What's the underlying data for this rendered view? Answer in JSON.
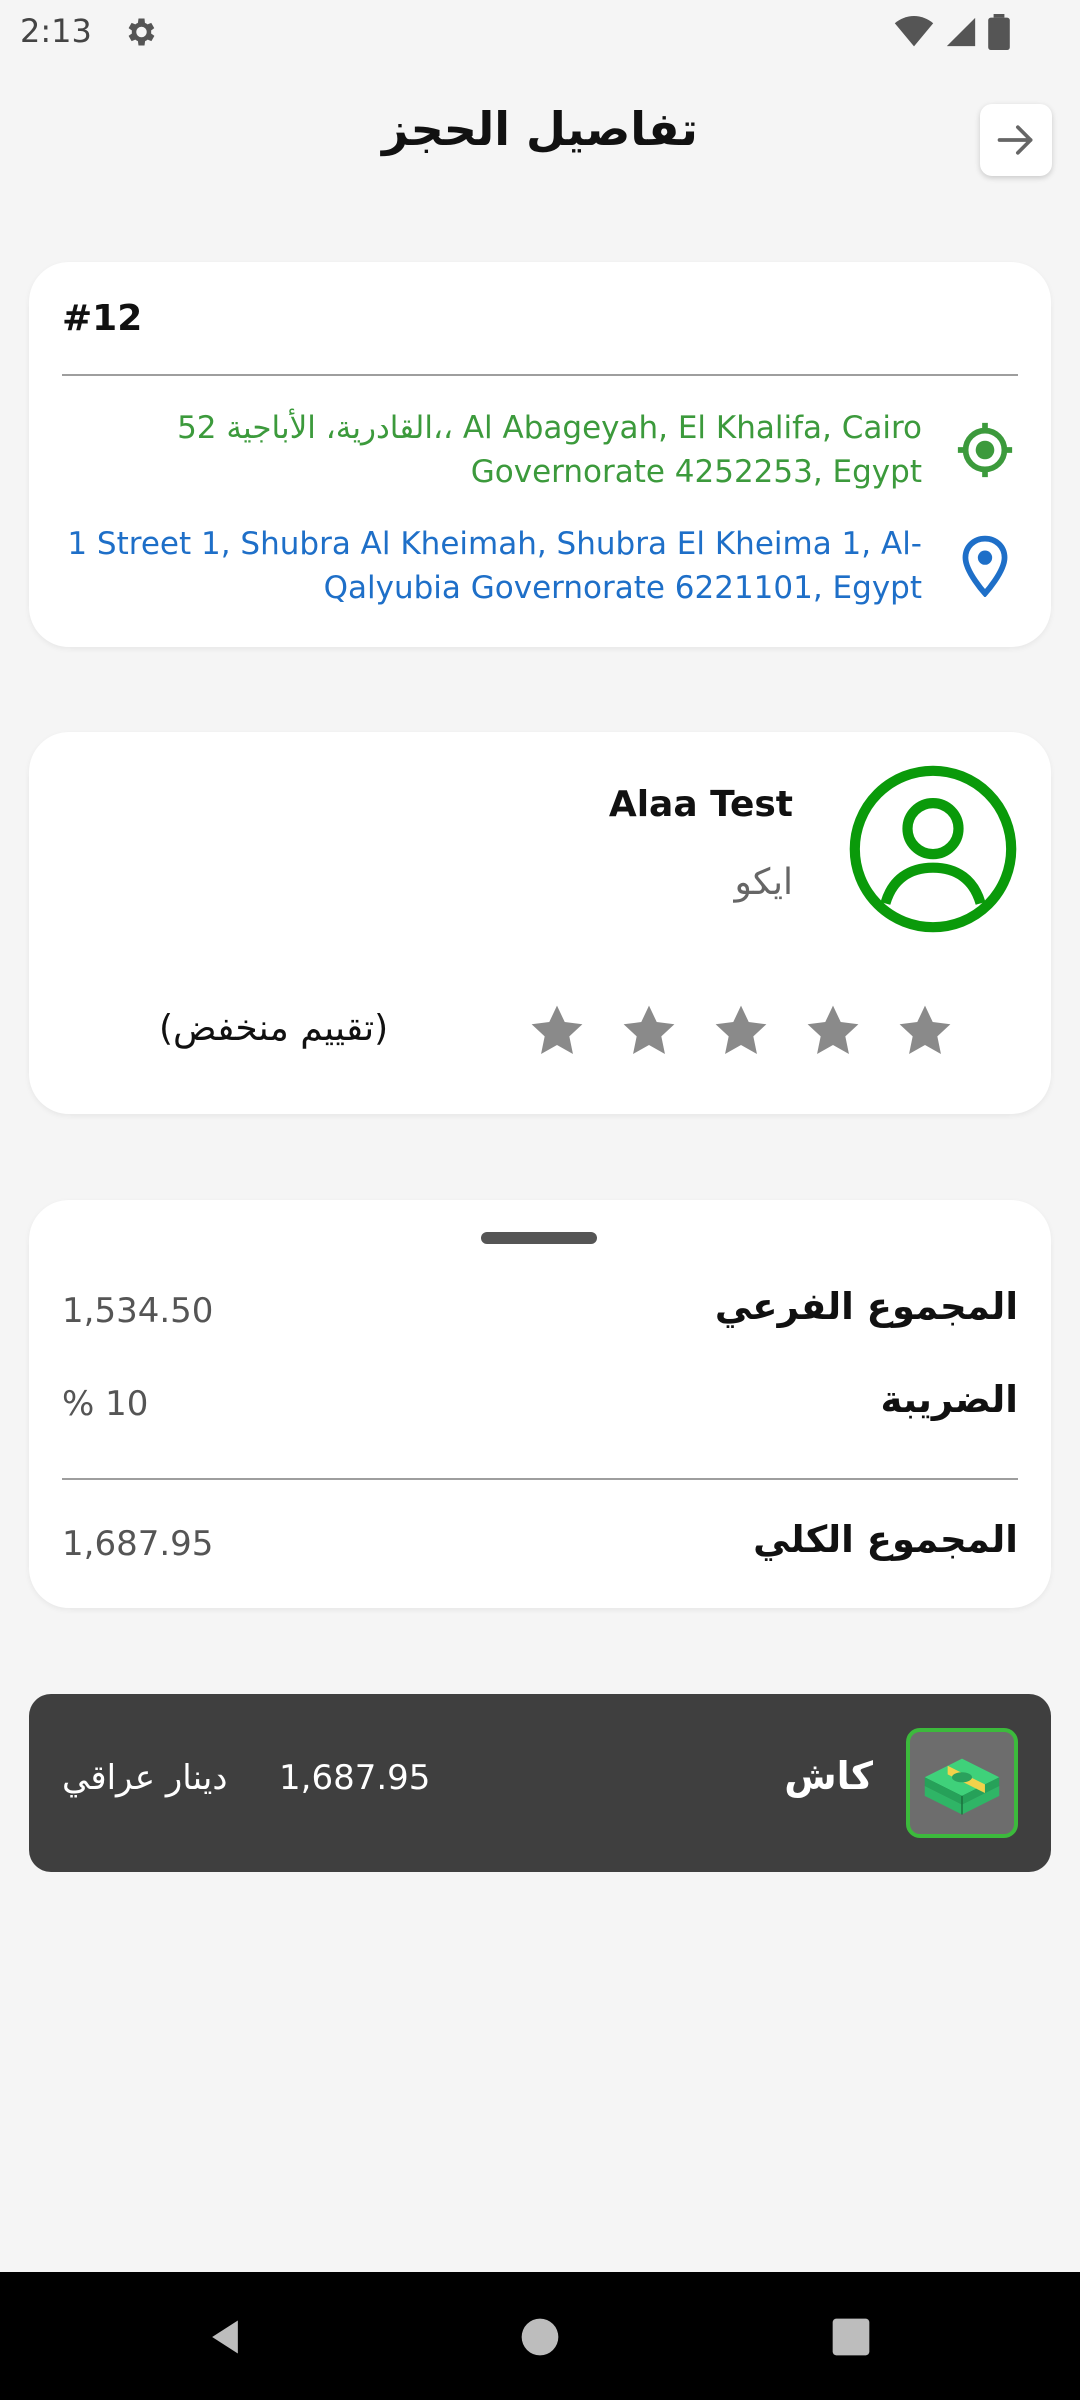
{
  "status_bar": {
    "time": "2:13"
  },
  "header": {
    "title": "تفاصيل الحجز"
  },
  "booking": {
    "number": "#12",
    "pickup_address": "52 القادرية، الأباجية،، Al Abageyah, El Khalifa, Cairo Governorate 4252253, Egypt",
    "dropoff_address": "1 Street 1, Shubra Al Kheimah, Shubra El Kheima 1, Al-Qalyubia Governorate 6221101, Egypt"
  },
  "driver": {
    "name": "Alaa Test",
    "car": "ايكو",
    "rating_label": "(تقييم منخفض)",
    "rating": 0,
    "rating_max": 5
  },
  "summary": {
    "subtotal_label": "المجموع الفرعي",
    "subtotal_value": "1,534.50",
    "tax_label": "الضريبة",
    "tax_value": "% 10",
    "total_label": "المجموع الكلي",
    "total_value": "1,687.95"
  },
  "payment": {
    "method": "كاش",
    "amount": "1,687.95",
    "currency": "دينار عراقي"
  },
  "colors": {
    "pickup": "#3c9a3c",
    "dropoff": "#1e6fc8",
    "avatar": "#0a9a0a",
    "star_empty": "#8a8a8a",
    "payment_bg": "#3f3f3f"
  }
}
